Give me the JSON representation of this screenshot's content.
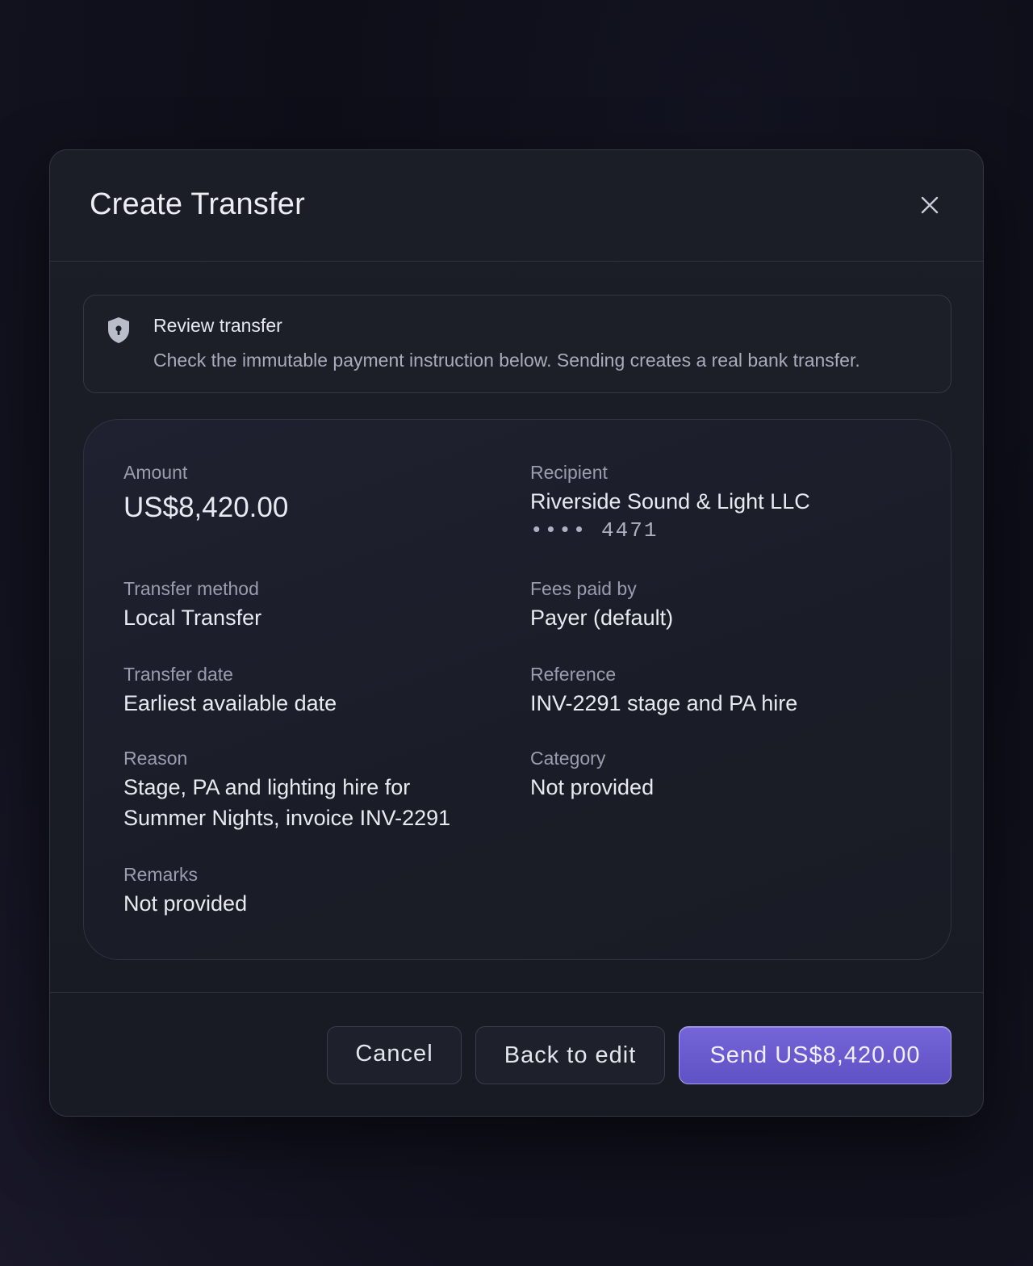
{
  "modal": {
    "title": "Create Transfer",
    "close_icon": "close-icon"
  },
  "notice": {
    "icon": "shield-lock-icon",
    "title": "Review transfer",
    "text": "Check the immutable payment instruction below. Sending creates a real bank transfer."
  },
  "details": {
    "amount": {
      "label": "Amount",
      "value": "US$8,420.00"
    },
    "recipient": {
      "label": "Recipient",
      "value": "Riverside Sound & Light LLC",
      "account": "•••• 4471"
    },
    "transfer_method": {
      "label": "Transfer method",
      "value": "Local Transfer"
    },
    "fees_paid_by": {
      "label": "Fees paid by",
      "value": "Payer (default)"
    },
    "transfer_date": {
      "label": "Transfer date",
      "value": "Earliest available date"
    },
    "reference": {
      "label": "Reference",
      "value": "INV-2291 stage and PA hire"
    },
    "reason": {
      "label": "Reason",
      "value_line1": "Stage, PA and lighting hire for",
      "value_line2": "Summer Nights, invoice INV-2291"
    },
    "category": {
      "label": "Category",
      "value": "Not provided"
    },
    "remarks": {
      "label": "Remarks",
      "value": "Not provided"
    }
  },
  "footer": {
    "cancel_label": "Cancel",
    "back_label": "Back to edit",
    "send_label": "Send US$8,420.00"
  },
  "colors": {
    "accent": "#6a5cd0",
    "background": "#0d0e18",
    "surface": "#1b1d27"
  }
}
